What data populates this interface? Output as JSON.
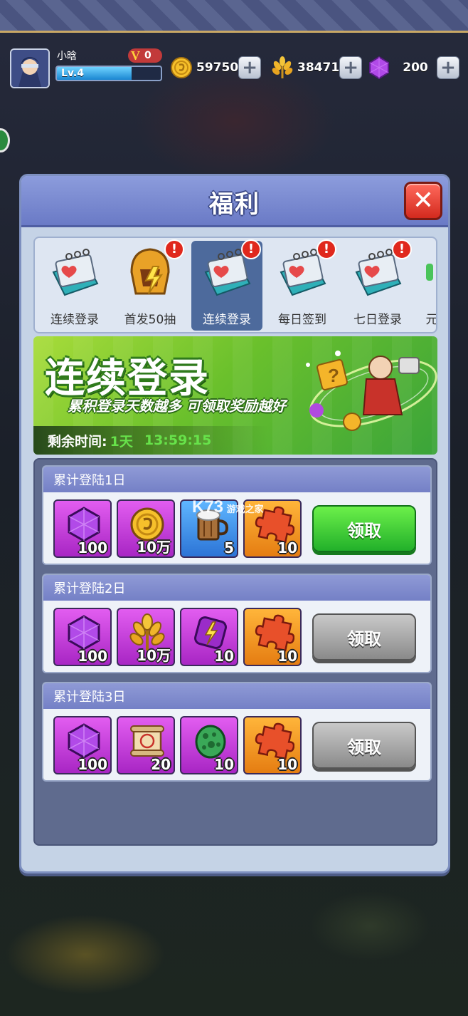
{
  "player": {
    "name": "小晗",
    "vip": "0",
    "level": "Lv.4",
    "level_progress": 0.72
  },
  "resources": {
    "coins": "59750",
    "wheat": "38471",
    "gems": "200"
  },
  "modal": {
    "title": "福利",
    "tabs": [
      {
        "label": "连续登录",
        "alert": false,
        "active": false
      },
      {
        "label": "首发50抽",
        "alert": true,
        "active": false
      },
      {
        "label": "连续登录",
        "alert": true,
        "active": true
      },
      {
        "label": "每日签到",
        "alert": true,
        "active": false
      },
      {
        "label": "七日登录",
        "alert": true,
        "active": false
      },
      {
        "label": "元",
        "alert": false,
        "active": false
      }
    ],
    "banner": {
      "title": "连续登录",
      "subtitle": "累积登录天数越多 可领取奖励越好",
      "timer_label": "剩余时间:",
      "timer_days": "1天",
      "timer_time": "13:59:15"
    },
    "rewards": [
      {
        "title": "累计登陆1日",
        "claim_label": "领取",
        "claimable": true,
        "items": [
          {
            "icon": "gem-icon",
            "qty": "100",
            "color": "purple"
          },
          {
            "icon": "gold-coin-icon",
            "qty": "10万",
            "color": "purple"
          },
          {
            "icon": "beer-mug-icon",
            "qty": "5",
            "color": "blue"
          },
          {
            "icon": "puzzle-piece-icon",
            "qty": "10",
            "color": "orange"
          }
        ]
      },
      {
        "title": "累计登陆2日",
        "claim_label": "领取",
        "claimable": false,
        "items": [
          {
            "icon": "gem-icon",
            "qty": "100",
            "color": "purple"
          },
          {
            "icon": "wheat-icon",
            "qty": "10万",
            "color": "purple"
          },
          {
            "icon": "lightning-gem-icon",
            "qty": "10",
            "color": "purple"
          },
          {
            "icon": "puzzle-piece-icon",
            "qty": "10",
            "color": "orange"
          }
        ]
      },
      {
        "title": "累计登陆3日",
        "claim_label": "领取",
        "claimable": false,
        "items": [
          {
            "icon": "gem-icon",
            "qty": "100",
            "color": "purple"
          },
          {
            "icon": "scroll-icon",
            "qty": "20",
            "color": "purple"
          },
          {
            "icon": "dino-egg-icon",
            "qty": "10",
            "color": "purple"
          },
          {
            "icon": "puzzle-piece-icon",
            "qty": "10",
            "color": "orange"
          }
        ]
      }
    ]
  },
  "watermark": {
    "brand": "K73",
    "text": "游戏之家"
  }
}
